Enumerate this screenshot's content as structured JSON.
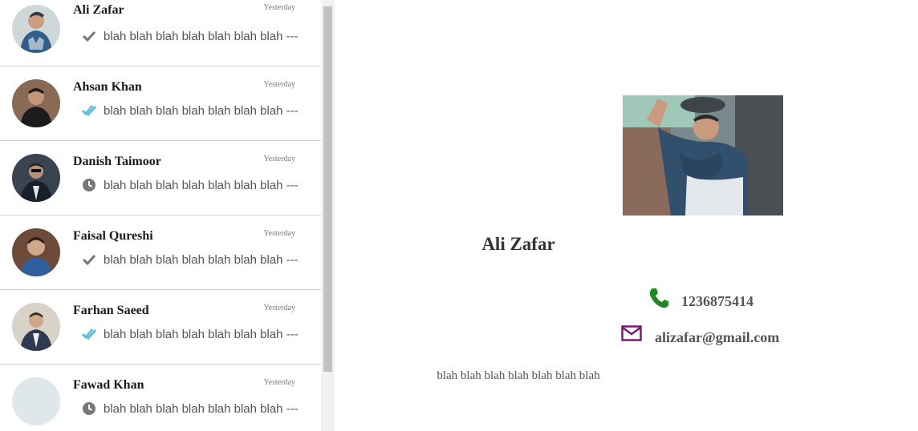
{
  "chats": [
    {
      "name": "Ali Zafar",
      "time": "Yesterday",
      "preview": "blah blah blah blah blah blah blah ---",
      "status_icon": "check-icon",
      "status_color": "#777777"
    },
    {
      "name": "Ahsan Khan",
      "time": "Yesterday",
      "preview": "blah blah blah blah blah blah blah ---",
      "status_icon": "double-check-icon",
      "status_color": "#5bc0de"
    },
    {
      "name": "Danish Taimoor",
      "time": "Yesterday",
      "preview": "blah blah blah blah blah blah blah ---",
      "status_icon": "clock-icon",
      "status_color": "#777777"
    },
    {
      "name": "Faisal Qureshi",
      "time": "Yesterday",
      "preview": "blah blah blah blah blah blah blah ---",
      "status_icon": "check-icon",
      "status_color": "#777777"
    },
    {
      "name": "Farhan Saeed",
      "time": "Yesterday",
      "preview": "blah blah blah blah blah blah blah ---",
      "status_icon": "double-check-icon",
      "status_color": "#5bc0de"
    },
    {
      "name": "Fawad Khan",
      "time": "Yesterday",
      "preview": "blah blah blah blah blah blah blah ---",
      "status_icon": "clock-icon",
      "status_color": "#777777"
    }
  ],
  "profile": {
    "name": "Ali Zafar",
    "phone": "1236875414",
    "email": "alizafar@gmail.com",
    "bio": "blah blah blah blah blah blah blah",
    "phone_icon": "phone-icon",
    "phone_color": "#1f8a1f",
    "email_icon": "envelope-icon",
    "email_color": "#7a1a7a"
  }
}
